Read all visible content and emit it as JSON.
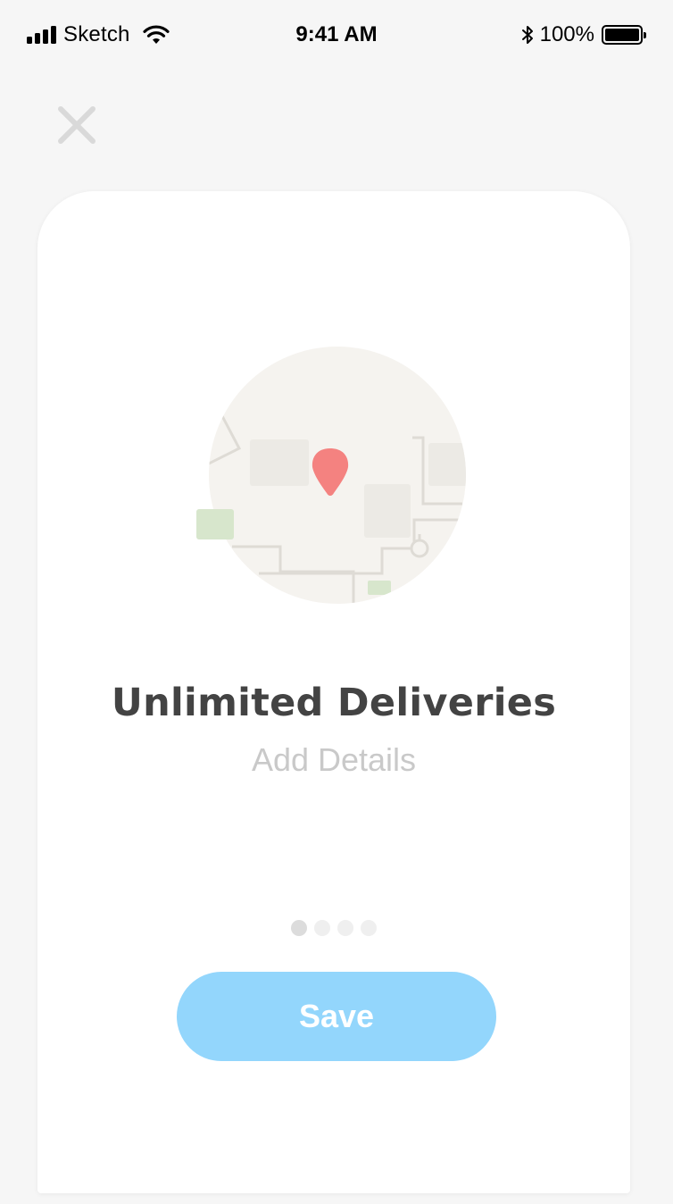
{
  "status_bar": {
    "carrier": "Sketch",
    "time": "9:41 AM",
    "battery_percent": "100%",
    "battery_level": 1.0,
    "signal_bars": 4
  },
  "header": {
    "close_icon": "close-x-icon",
    "close_color": "#d9d9d9"
  },
  "card": {
    "illustration_icon": "map-location-pin-icon",
    "pin_color": "#f48280",
    "title": "Unlimited Deliveries",
    "subtitle": "Add Details",
    "pager": {
      "count": 4,
      "active_index": 0
    },
    "save_label": "Save",
    "save_color": "#93d6fc"
  }
}
